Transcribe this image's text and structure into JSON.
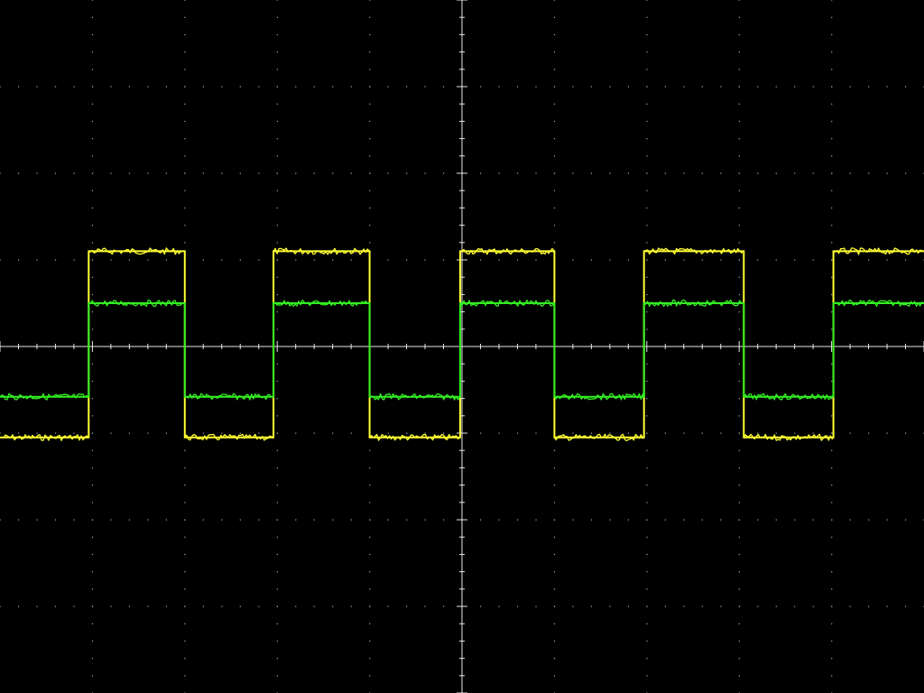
{
  "chart_data": {
    "type": "line",
    "title": "",
    "xlabel": "",
    "ylabel": "",
    "grid": true,
    "grid_style": "dotted",
    "x_divisions": 10,
    "y_divisions": 8,
    "xlim": [
      -5,
      5
    ],
    "ylim": [
      -4,
      4
    ],
    "series": [
      {
        "color": "#ffff33",
        "x": [
          -5,
          -4.04,
          -4.04,
          -3.0,
          -3.0,
          -2.04,
          -2.04,
          -1.0,
          -1.0,
          -0.02,
          -0.02,
          1.0,
          1.0,
          1.97,
          1.97,
          3.05,
          3.05,
          4.02,
          4.02,
          5
        ],
        "values": [
          -1.05,
          -1.05,
          1.1,
          1.1,
          -1.05,
          -1.05,
          1.1,
          1.1,
          -1.05,
          -1.05,
          1.1,
          1.1,
          -1.05,
          -1.05,
          1.1,
          1.1,
          -1.05,
          -1.05,
          1.1,
          1.1
        ]
      },
      {
        "color": "#33ee22",
        "x": [
          -5,
          -4.04,
          -4.04,
          -3.0,
          -3.0,
          -2.04,
          -2.04,
          -1.0,
          -1.0,
          -0.02,
          -0.02,
          1.0,
          1.0,
          1.97,
          1.97,
          3.05,
          3.05,
          4.02,
          4.02,
          5
        ],
        "values": [
          -0.58,
          -0.58,
          0.5,
          0.5,
          -0.58,
          -0.58,
          0.5,
          0.5,
          -0.58,
          -0.58,
          0.5,
          0.5,
          -0.58,
          -0.58,
          0.5,
          0.5,
          -0.58,
          -0.58,
          0.5,
          0.5
        ]
      }
    ]
  },
  "colors": {
    "background": "#000000",
    "grid": "#aaaaaa",
    "axis": "#e6e6e6"
  }
}
